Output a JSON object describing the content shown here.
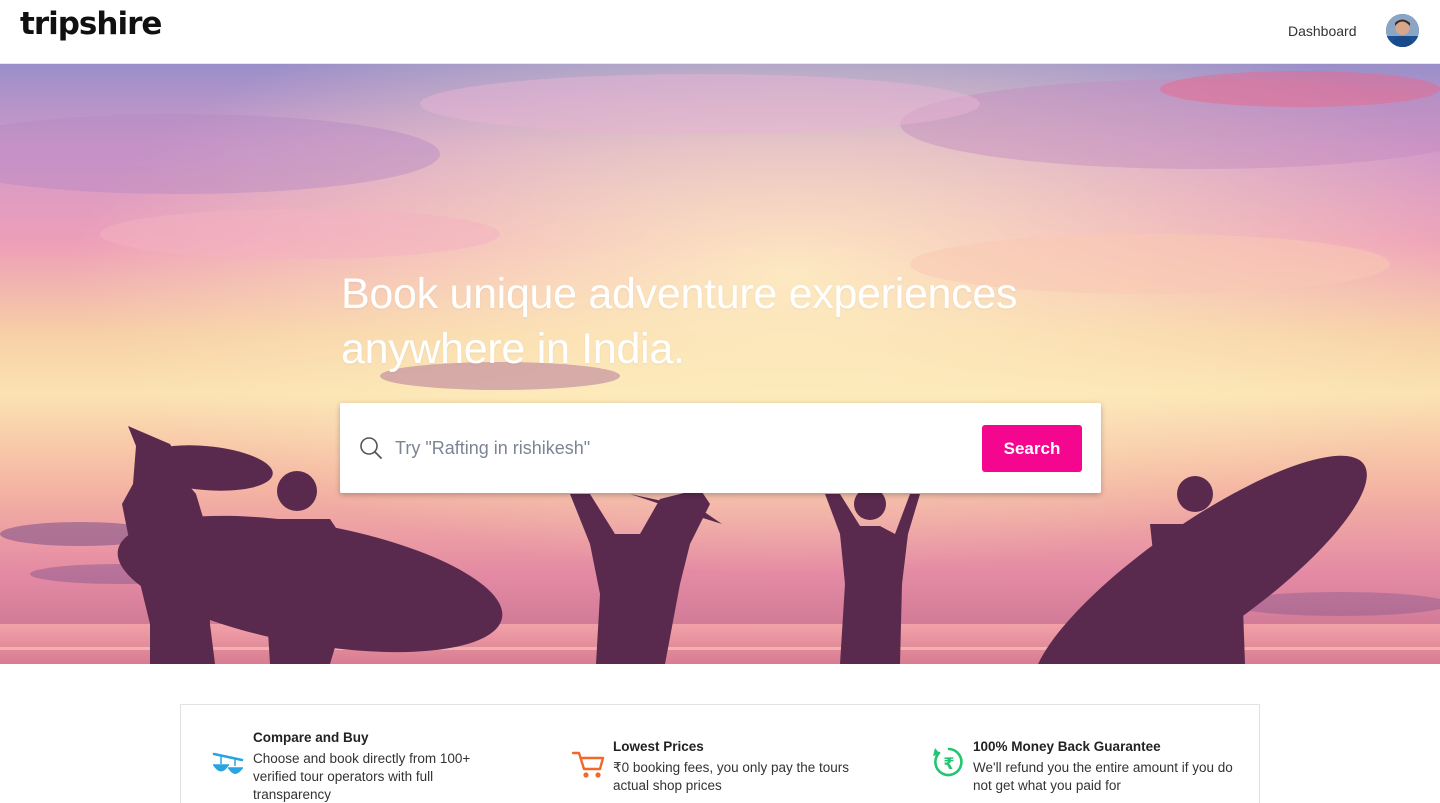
{
  "header": {
    "logo": "tripshire",
    "nav_dashboard": "Dashboard"
  },
  "hero": {
    "title_line1": "Book unique adventure experiences",
    "title_line2": "anywhere in India."
  },
  "search": {
    "placeholder": "Try \"Rafting in rishikesh\"",
    "value": "",
    "button_label": "Search"
  },
  "features": [
    {
      "icon": "scales-icon",
      "title": "Compare and Buy",
      "desc": "Choose and book directly from 100+ verified tour operators with full transparency"
    },
    {
      "icon": "cart-icon",
      "title": "Lowest Prices",
      "desc": "₹0 booking fees, you only pay the tours actual shop prices"
    },
    {
      "icon": "rupee-refund-icon",
      "title": "100% Money Back Guarantee",
      "desc": "We'll refund you the entire amount if you do not get what you paid for"
    }
  ],
  "colors": {
    "accent": "#f5068f",
    "feature_blue": "#2aa4e0",
    "feature_orange": "#f0692b",
    "feature_green": "#22c672",
    "silhouette": "#5a2a4e"
  }
}
